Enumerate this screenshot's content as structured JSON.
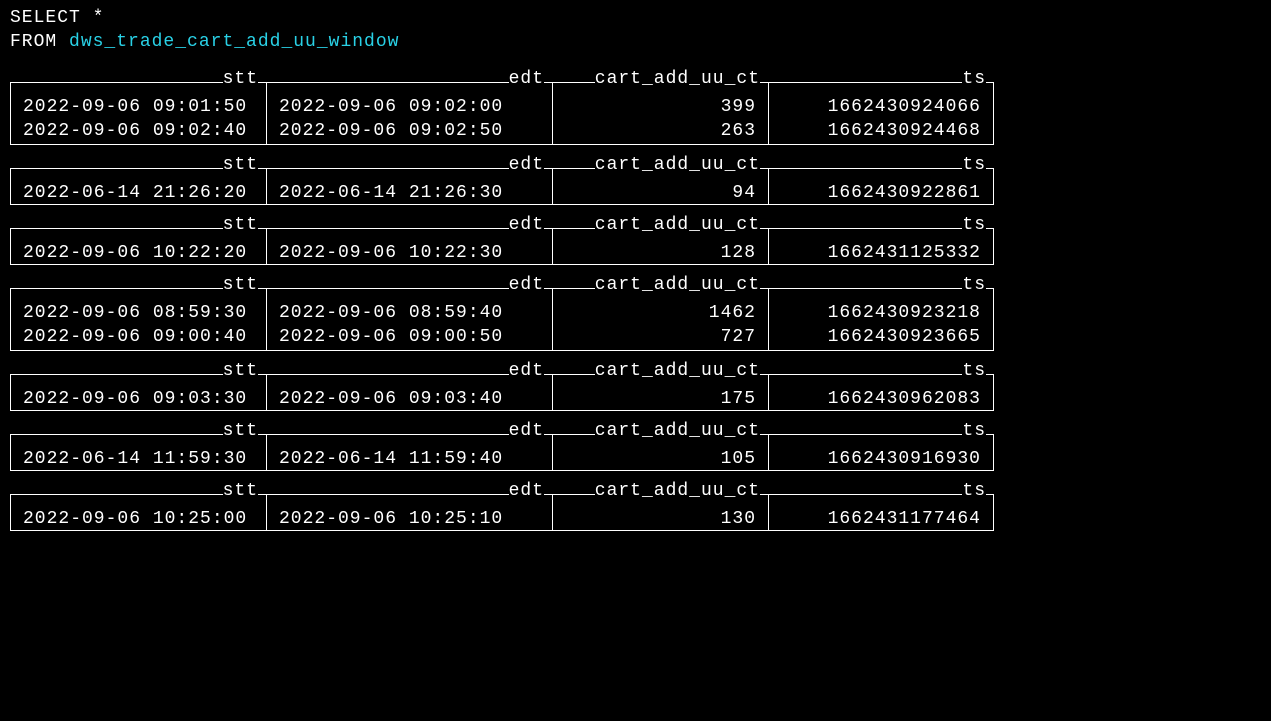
{
  "sql": {
    "line1_kw": "SELECT *",
    "line2_kw": "FROM ",
    "table": "dws_trade_cart_add_uu_window"
  },
  "columns": [
    "stt",
    "edt",
    "cart_add_uu_ct",
    "ts"
  ],
  "blocks": [
    {
      "rows": [
        {
          "stt": "2022-09-06 09:01:50",
          "edt": "2022-09-06 09:02:00",
          "ct": "399",
          "ts": "1662430924066"
        },
        {
          "stt": "2022-09-06 09:02:40",
          "edt": "2022-09-06 09:02:50",
          "ct": "263",
          "ts": "1662430924468"
        }
      ]
    },
    {
      "rows": [
        {
          "stt": "2022-06-14 21:26:20",
          "edt": "2022-06-14 21:26:30",
          "ct": "94",
          "ts": "1662430922861"
        }
      ]
    },
    {
      "rows": [
        {
          "stt": "2022-09-06 10:22:20",
          "edt": "2022-09-06 10:22:30",
          "ct": "128",
          "ts": "1662431125332"
        }
      ]
    },
    {
      "rows": [
        {
          "stt": "2022-09-06 08:59:30",
          "edt": "2022-09-06 08:59:40",
          "ct": "1462",
          "ts": "1662430923218"
        },
        {
          "stt": "2022-09-06 09:00:40",
          "edt": "2022-09-06 09:00:50",
          "ct": "727",
          "ts": "1662430923665"
        }
      ]
    },
    {
      "rows": [
        {
          "stt": "2022-09-06 09:03:30",
          "edt": "2022-09-06 09:03:40",
          "ct": "175",
          "ts": "1662430962083"
        }
      ]
    },
    {
      "rows": [
        {
          "stt": "2022-06-14 11:59:30",
          "edt": "2022-06-14 11:59:40",
          "ct": "105",
          "ts": "1662430916930"
        }
      ]
    },
    {
      "rows": [
        {
          "stt": "2022-09-06 10:25:00",
          "edt": "2022-09-06 10:25:10",
          "ct": "130",
          "ts": "1662431177464"
        }
      ]
    }
  ]
}
